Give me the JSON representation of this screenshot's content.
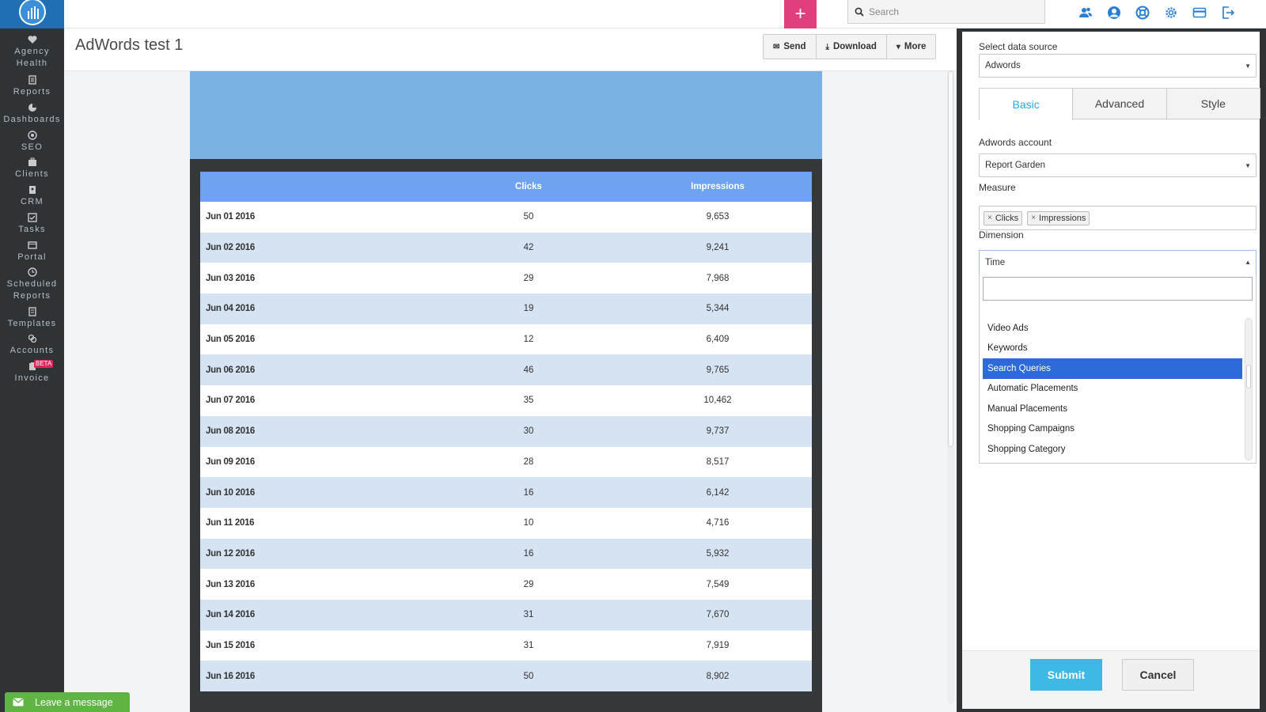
{
  "sidebar": {
    "items": [
      {
        "label": "Agency Health",
        "icon": "heart-icon"
      },
      {
        "label": "Reports",
        "icon": "document-icon"
      },
      {
        "label": "Dashboards",
        "icon": "pie-chart-icon"
      },
      {
        "label": "SEO",
        "icon": "target-icon"
      },
      {
        "label": "Clients",
        "icon": "briefcase-icon"
      },
      {
        "label": "CRM",
        "icon": "contact-book-icon"
      },
      {
        "label": "Tasks",
        "icon": "checkbox-icon"
      },
      {
        "label": "Portal",
        "icon": "browser-window-icon"
      },
      {
        "label": "Scheduled Reports",
        "icon": "clock-icon"
      },
      {
        "label": "Templates",
        "icon": "template-icon"
      },
      {
        "label": "Accounts",
        "icon": "link-icon"
      },
      {
        "label": "Invoice",
        "icon": "invoice-icon",
        "badge": "BETA"
      }
    ]
  },
  "topbar": {
    "add_label": "+",
    "search_placeholder": "Search"
  },
  "page": {
    "title": "AdWords test 1",
    "actions": {
      "send": "Send",
      "download": "Download",
      "more": "More"
    }
  },
  "report_table": {
    "headers": [
      "",
      "Clicks",
      "Impressions"
    ],
    "rows": [
      {
        "date": "Jun 01 2016",
        "clicks": "50",
        "impressions": "9,653"
      },
      {
        "date": "Jun 02 2016",
        "clicks": "42",
        "impressions": "9,241"
      },
      {
        "date": "Jun 03 2016",
        "clicks": "29",
        "impressions": "7,968"
      },
      {
        "date": "Jun 04 2016",
        "clicks": "19",
        "impressions": "5,344"
      },
      {
        "date": "Jun 05 2016",
        "clicks": "12",
        "impressions": "6,409"
      },
      {
        "date": "Jun 06 2016",
        "clicks": "46",
        "impressions": "9,765"
      },
      {
        "date": "Jun 07 2016",
        "clicks": "35",
        "impressions": "10,462"
      },
      {
        "date": "Jun 08 2016",
        "clicks": "30",
        "impressions": "9,737"
      },
      {
        "date": "Jun 09 2016",
        "clicks": "28",
        "impressions": "8,517"
      },
      {
        "date": "Jun 10 2016",
        "clicks": "16",
        "impressions": "6,142"
      },
      {
        "date": "Jun 11 2016",
        "clicks": "10",
        "impressions": "4,716"
      },
      {
        "date": "Jun 12 2016",
        "clicks": "16",
        "impressions": "5,932"
      },
      {
        "date": "Jun 13 2016",
        "clicks": "29",
        "impressions": "7,549"
      },
      {
        "date": "Jun 14 2016",
        "clicks": "31",
        "impressions": "7,670"
      },
      {
        "date": "Jun 15 2016",
        "clicks": "31",
        "impressions": "7,919"
      },
      {
        "date": "Jun 16 2016",
        "clicks": "50",
        "impressions": "8,902"
      }
    ]
  },
  "chat": {
    "label": "Leave a message"
  },
  "panel": {
    "data_source_label": "Select data source",
    "data_source_value": "Adwords",
    "tabs": [
      "Basic",
      "Advanced",
      "Style"
    ],
    "active_tab": "Basic",
    "account_label": "Adwords account",
    "account_value": "Report Garden",
    "measure_label": "Measure",
    "measures": [
      "Clicks",
      "Impressions"
    ],
    "dimension_label": "Dimension",
    "dimension_value": "Time",
    "dimension_options": [
      "Video Ads",
      "Keywords",
      "Search Queries",
      "Automatic Placements",
      "Manual Placements",
      "Shopping Campaigns",
      "Shopping Category"
    ],
    "dimension_highlighted": "Search Queries",
    "submit_label": "Submit",
    "cancel_label": "Cancel"
  },
  "colors": {
    "sidebar_bg": "#2f3336",
    "accent_pink": "#e03f7d",
    "table_header": "#6fa2f0",
    "banner": "#7ab2e3",
    "row_alt": "#d5e3f2",
    "submit": "#3fb8e4",
    "chat": "#5fb444",
    "tab_active": "#27a7d8",
    "selected_option": "#2b6ad8"
  }
}
